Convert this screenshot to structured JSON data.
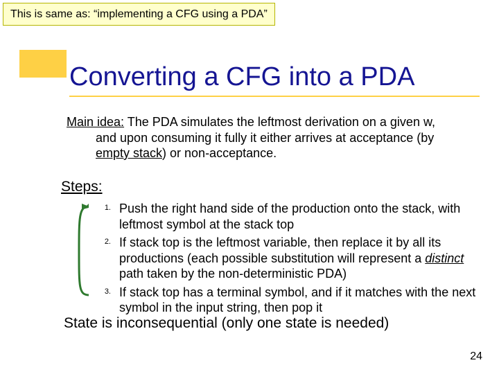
{
  "callout": "This is same as: “implementing a CFG using a PDA”",
  "title": "Converting a CFG into a PDA",
  "main_idea": {
    "label": "Main idea:",
    "line1_rest": " The PDA simulates the leftmost derivation on a given w,",
    "line2": "and upon consuming it fully it either arrives at acceptance (by",
    "line3_prefix": "",
    "empty_stack": "empty stack",
    "line3_suffix": ") or non-acceptance."
  },
  "steps_label": "Steps:",
  "steps": [
    {
      "num": "1.",
      "text": "Push the right hand side of the production onto the stack, with leftmost symbol at the stack top"
    },
    {
      "num": "2.",
      "pre": "If stack top is the leftmost variable, then replace it by all its productions (each possible substitution will represent a ",
      "distinct": "distinct ",
      "post": "path taken by the non-deterministic PDA)"
    },
    {
      "num": "3.",
      "text": "If stack top has a terminal symbol, and if it matches with the next symbol in the input string, then pop it"
    }
  ],
  "footnote": "State is inconsequential (only one state is needed)",
  "pagenum": "24"
}
